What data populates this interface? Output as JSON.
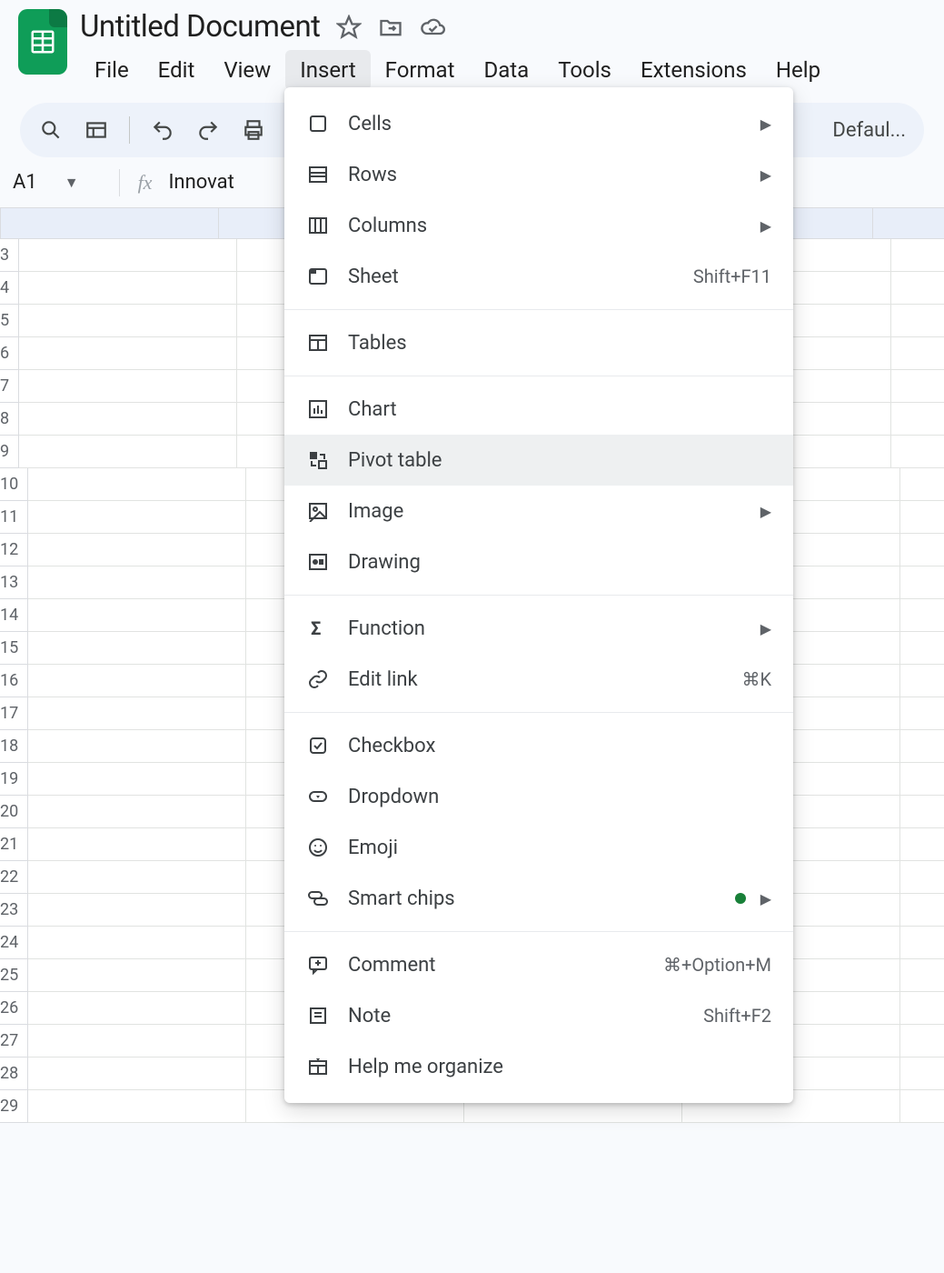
{
  "doc": {
    "title": "Untitled Document"
  },
  "menubar": {
    "items": [
      "File",
      "Edit",
      "View",
      "Insert",
      "Format",
      "Data",
      "Tools",
      "Extensions",
      "Help"
    ],
    "active_index": 3
  },
  "toolbar": {
    "truncated_right_text": "Defaul..."
  },
  "name_box": {
    "ref": "A1"
  },
  "formula_bar": {
    "value": "Innovat"
  },
  "grid": {
    "first_visible_row": 3,
    "last_visible_row": 29
  },
  "insert_menu": {
    "groups": [
      [
        {
          "id": "cells",
          "label": "Cells",
          "submenu": true
        },
        {
          "id": "rows",
          "label": "Rows",
          "submenu": true
        },
        {
          "id": "columns",
          "label": "Columns",
          "submenu": true
        },
        {
          "id": "sheet",
          "label": "Sheet",
          "accel": "Shift+F11"
        }
      ],
      [
        {
          "id": "tables",
          "label": "Tables"
        }
      ],
      [
        {
          "id": "chart",
          "label": "Chart"
        },
        {
          "id": "pivot",
          "label": "Pivot table",
          "hover": true
        },
        {
          "id": "image",
          "label": "Image",
          "submenu": true
        },
        {
          "id": "drawing",
          "label": "Drawing"
        }
      ],
      [
        {
          "id": "function",
          "label": "Function",
          "submenu": true
        },
        {
          "id": "link",
          "label": "Edit link",
          "accel": "⌘K"
        }
      ],
      [
        {
          "id": "checkbox",
          "label": "Checkbox"
        },
        {
          "id": "dropdown",
          "label": "Dropdown"
        },
        {
          "id": "emoji",
          "label": "Emoji"
        },
        {
          "id": "chips",
          "label": "Smart chips",
          "submenu": true,
          "dot": true
        }
      ],
      [
        {
          "id": "comment",
          "label": "Comment",
          "accel": "⌘+Option+M"
        },
        {
          "id": "note",
          "label": "Note",
          "accel": "Shift+F2"
        },
        {
          "id": "organize",
          "label": "Help me organize"
        }
      ]
    ]
  }
}
